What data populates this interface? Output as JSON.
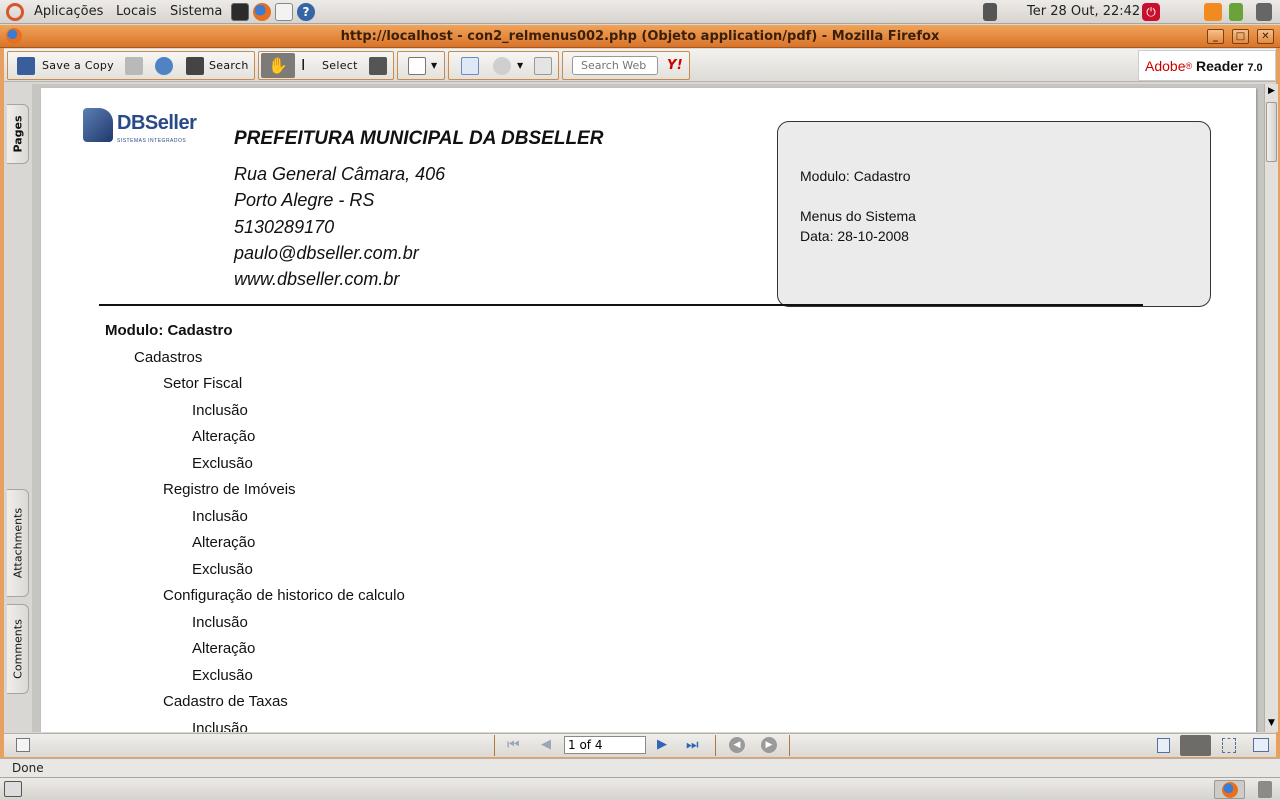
{
  "top_panel": {
    "menus": [
      "Aplicações",
      "Locais",
      "Sistema"
    ],
    "clock": "Ter 28 Out, 22:42"
  },
  "window": {
    "title": "http://localhost - con2_relmenus002.php (Objeto application/pdf) - Mozilla Firefox"
  },
  "toolbar": {
    "save_copy": "Save a Copy",
    "search": "Search",
    "select": "Select",
    "search_web_placeholder": "Search Web",
    "yahoo": "Y!",
    "brand": "Adobe",
    "brand_reader": "Reader",
    "brand_version": "7.0"
  },
  "side_tabs": {
    "pages": "Pages",
    "attachments": "Attachments",
    "comments": "Comments"
  },
  "document": {
    "logo_name": "DBSeller",
    "logo_tagline": "SISTEMAS INTEGRADOS",
    "org_name": "PREFEITURA MUNICIPAL DA DBSELLER",
    "address": "Rua General Câmara, 406",
    "city": "Porto Alegre - RS",
    "phone": "5130289170",
    "email": "paulo@dbseller.com.br",
    "website": "www.dbseller.com.br",
    "info_module": "Modulo: Cadastro",
    "info_title": "Menus do Sistema",
    "info_date": "Data: 28-10-2008",
    "tree": [
      {
        "level": 0,
        "text": "Modulo: Cadastro",
        "bold": true
      },
      {
        "level": 1,
        "text": "Cadastros"
      },
      {
        "level": 2,
        "text": "Setor Fiscal"
      },
      {
        "level": 3,
        "text": "Inclusão"
      },
      {
        "level": 3,
        "text": "Alteração"
      },
      {
        "level": 3,
        "text": "Exclusão"
      },
      {
        "level": 2,
        "text": "Registro de Imóveis"
      },
      {
        "level": 3,
        "text": "Inclusão"
      },
      {
        "level": 3,
        "text": "Alteração"
      },
      {
        "level": 3,
        "text": "Exclusão"
      },
      {
        "level": 2,
        "text": "Configuração de historico de calculo"
      },
      {
        "level": 3,
        "text": "Inclusão"
      },
      {
        "level": 3,
        "text": "Alteração"
      },
      {
        "level": 3,
        "text": "Exclusão"
      },
      {
        "level": 2,
        "text": "Cadastro de Taxas"
      },
      {
        "level": 3,
        "text": "Inclusão"
      }
    ]
  },
  "navbar": {
    "page_indicator": "1 of 4"
  },
  "statusbar": {
    "text": "Done"
  }
}
